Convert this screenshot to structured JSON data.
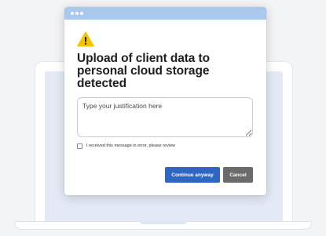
{
  "dialog": {
    "heading": "Upload of client data to personal cloud storage detected",
    "justification_placeholder": "Type your justification here",
    "error_checkbox_label": "I received this message in error, please review",
    "continue_label": "Continue anyway",
    "cancel_label": "Cancel",
    "icon": "warning-icon"
  },
  "colors": {
    "titlebar": "#a8c8ee",
    "primary_button": "#2f66c2",
    "secondary_button": "#6b6b6b",
    "warning": "#f5c400"
  }
}
